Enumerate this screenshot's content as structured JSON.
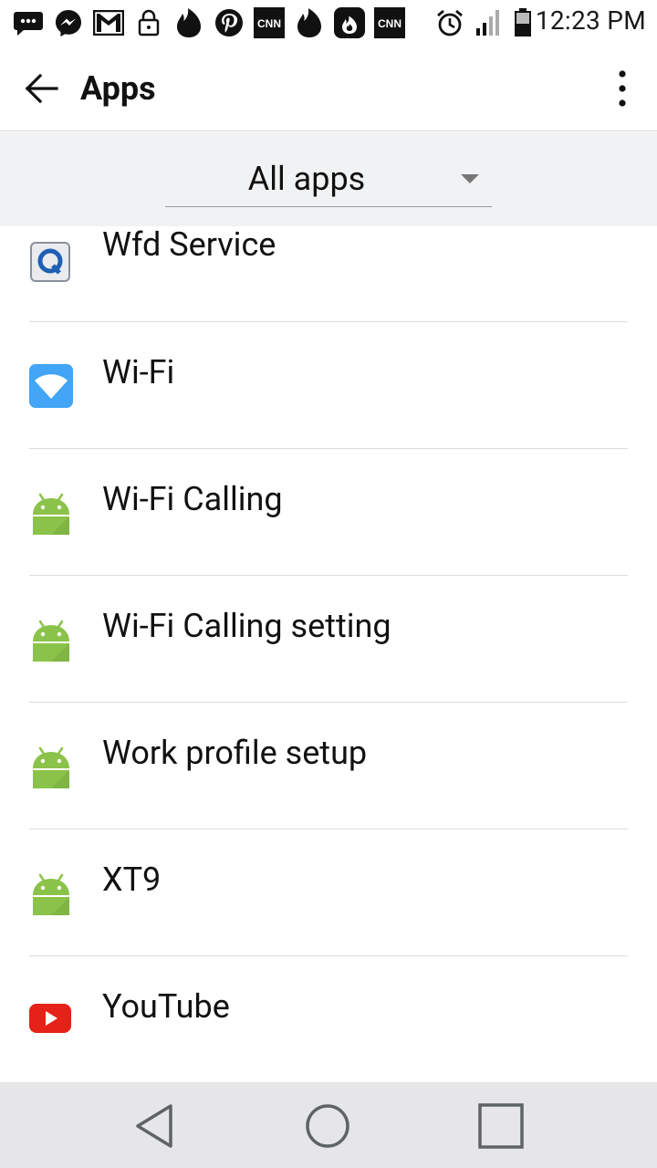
{
  "status_bar": {
    "time": "12:23 PM",
    "notification_icons": [
      "chat-bubble-icon",
      "messenger-icon",
      "gmail-icon",
      "lock-icon",
      "tinder-flame-icon",
      "pinterest-icon",
      "cnn-icon",
      "tinder-flame-icon",
      "tinder-flame-icon",
      "cnn-icon"
    ],
    "system_icons": [
      "alarm-icon",
      "signal-icon",
      "battery-icon"
    ],
    "cnn_text": "CNN"
  },
  "app_bar": {
    "title": "Apps",
    "back_icon": "arrow-back-icon",
    "menu_icon": "more-vert-icon"
  },
  "filter": {
    "selected": "All apps"
  },
  "apps": [
    {
      "label": "Wfd Service",
      "icon": "qualcomm-icon"
    },
    {
      "label": "Wi-Fi",
      "icon": "wifi-icon"
    },
    {
      "label": "Wi-Fi Calling",
      "icon": "android-icon"
    },
    {
      "label": "Wi-Fi Calling setting",
      "icon": "android-icon"
    },
    {
      "label": "Work profile setup",
      "icon": "android-icon"
    },
    {
      "label": "XT9",
      "icon": "android-icon"
    },
    {
      "label": "YouTube",
      "icon": "youtube-icon"
    }
  ],
  "nav_bar": {
    "back": "nav-back-icon",
    "home": "nav-home-icon",
    "recents": "nav-recents-icon"
  },
  "colors": {
    "android_green": "#8bc34a",
    "wifi_blue": "#42a5f5",
    "youtube_red": "#e62117",
    "filter_bg": "#f1f2f3",
    "navbar_bg": "#e6e6e8"
  }
}
